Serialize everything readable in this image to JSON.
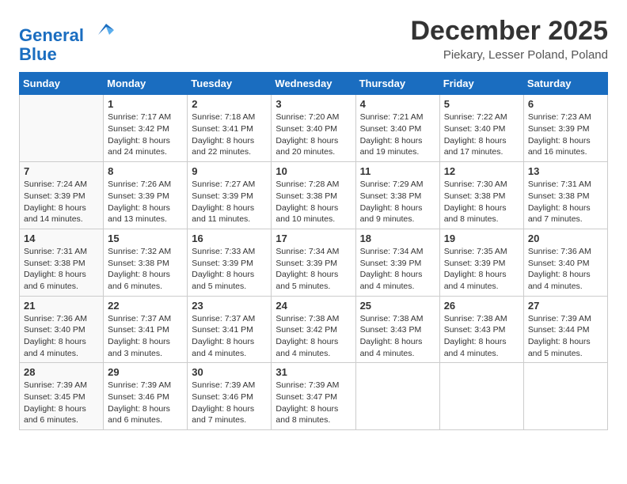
{
  "logo": {
    "line1": "General",
    "line2": "Blue"
  },
  "title": "December 2025",
  "subtitle": "Piekary, Lesser Poland, Poland",
  "days": [
    "Sunday",
    "Monday",
    "Tuesday",
    "Wednesday",
    "Thursday",
    "Friday",
    "Saturday"
  ],
  "weeks": [
    [
      {
        "num": "",
        "text": ""
      },
      {
        "num": "1",
        "text": "Sunrise: 7:17 AM\nSunset: 3:42 PM\nDaylight: 8 hours\nand 24 minutes."
      },
      {
        "num": "2",
        "text": "Sunrise: 7:18 AM\nSunset: 3:41 PM\nDaylight: 8 hours\nand 22 minutes."
      },
      {
        "num": "3",
        "text": "Sunrise: 7:20 AM\nSunset: 3:40 PM\nDaylight: 8 hours\nand 20 minutes."
      },
      {
        "num": "4",
        "text": "Sunrise: 7:21 AM\nSunset: 3:40 PM\nDaylight: 8 hours\nand 19 minutes."
      },
      {
        "num": "5",
        "text": "Sunrise: 7:22 AM\nSunset: 3:40 PM\nDaylight: 8 hours\nand 17 minutes."
      },
      {
        "num": "6",
        "text": "Sunrise: 7:23 AM\nSunset: 3:39 PM\nDaylight: 8 hours\nand 16 minutes."
      }
    ],
    [
      {
        "num": "7",
        "text": "Sunrise: 7:24 AM\nSunset: 3:39 PM\nDaylight: 8 hours\nand 14 minutes."
      },
      {
        "num": "8",
        "text": "Sunrise: 7:26 AM\nSunset: 3:39 PM\nDaylight: 8 hours\nand 13 minutes."
      },
      {
        "num": "9",
        "text": "Sunrise: 7:27 AM\nSunset: 3:39 PM\nDaylight: 8 hours\nand 11 minutes."
      },
      {
        "num": "10",
        "text": "Sunrise: 7:28 AM\nSunset: 3:38 PM\nDaylight: 8 hours\nand 10 minutes."
      },
      {
        "num": "11",
        "text": "Sunrise: 7:29 AM\nSunset: 3:38 PM\nDaylight: 8 hours\nand 9 minutes."
      },
      {
        "num": "12",
        "text": "Sunrise: 7:30 AM\nSunset: 3:38 PM\nDaylight: 8 hours\nand 8 minutes."
      },
      {
        "num": "13",
        "text": "Sunrise: 7:31 AM\nSunset: 3:38 PM\nDaylight: 8 hours\nand 7 minutes."
      }
    ],
    [
      {
        "num": "14",
        "text": "Sunrise: 7:31 AM\nSunset: 3:38 PM\nDaylight: 8 hours\nand 6 minutes."
      },
      {
        "num": "15",
        "text": "Sunrise: 7:32 AM\nSunset: 3:38 PM\nDaylight: 8 hours\nand 6 minutes."
      },
      {
        "num": "16",
        "text": "Sunrise: 7:33 AM\nSunset: 3:39 PM\nDaylight: 8 hours\nand 5 minutes."
      },
      {
        "num": "17",
        "text": "Sunrise: 7:34 AM\nSunset: 3:39 PM\nDaylight: 8 hours\nand 5 minutes."
      },
      {
        "num": "18",
        "text": "Sunrise: 7:34 AM\nSunset: 3:39 PM\nDaylight: 8 hours\nand 4 minutes."
      },
      {
        "num": "19",
        "text": "Sunrise: 7:35 AM\nSunset: 3:39 PM\nDaylight: 8 hours\nand 4 minutes."
      },
      {
        "num": "20",
        "text": "Sunrise: 7:36 AM\nSunset: 3:40 PM\nDaylight: 8 hours\nand 4 minutes."
      }
    ],
    [
      {
        "num": "21",
        "text": "Sunrise: 7:36 AM\nSunset: 3:40 PM\nDaylight: 8 hours\nand 4 minutes."
      },
      {
        "num": "22",
        "text": "Sunrise: 7:37 AM\nSunset: 3:41 PM\nDaylight: 8 hours\nand 3 minutes."
      },
      {
        "num": "23",
        "text": "Sunrise: 7:37 AM\nSunset: 3:41 PM\nDaylight: 8 hours\nand 4 minutes."
      },
      {
        "num": "24",
        "text": "Sunrise: 7:38 AM\nSunset: 3:42 PM\nDaylight: 8 hours\nand 4 minutes."
      },
      {
        "num": "25",
        "text": "Sunrise: 7:38 AM\nSunset: 3:43 PM\nDaylight: 8 hours\nand 4 minutes."
      },
      {
        "num": "26",
        "text": "Sunrise: 7:38 AM\nSunset: 3:43 PM\nDaylight: 8 hours\nand 4 minutes."
      },
      {
        "num": "27",
        "text": "Sunrise: 7:39 AM\nSunset: 3:44 PM\nDaylight: 8 hours\nand 5 minutes."
      }
    ],
    [
      {
        "num": "28",
        "text": "Sunrise: 7:39 AM\nSunset: 3:45 PM\nDaylight: 8 hours\nand 6 minutes."
      },
      {
        "num": "29",
        "text": "Sunrise: 7:39 AM\nSunset: 3:46 PM\nDaylight: 8 hours\nand 6 minutes."
      },
      {
        "num": "30",
        "text": "Sunrise: 7:39 AM\nSunset: 3:46 PM\nDaylight: 8 hours\nand 7 minutes."
      },
      {
        "num": "31",
        "text": "Sunrise: 7:39 AM\nSunset: 3:47 PM\nDaylight: 8 hours\nand 8 minutes."
      },
      {
        "num": "",
        "text": ""
      },
      {
        "num": "",
        "text": ""
      },
      {
        "num": "",
        "text": ""
      }
    ]
  ]
}
